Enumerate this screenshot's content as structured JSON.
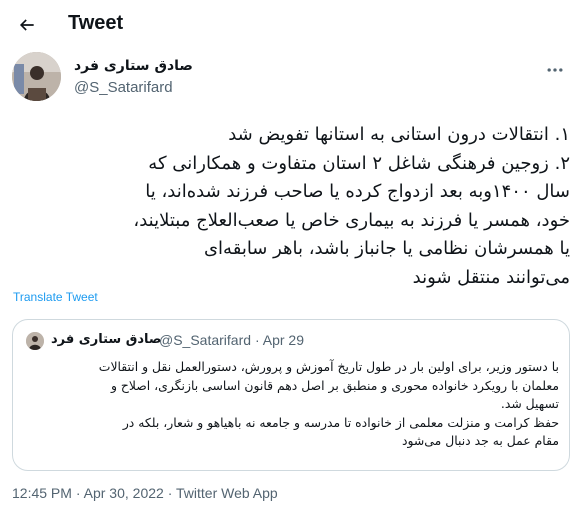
{
  "header": {
    "title": "Tweet",
    "back_icon": "arrow-left-icon"
  },
  "author": {
    "name": "صادق ستاری فرد",
    "handle": "@S_Satarifard",
    "more_icon": "more-horizontal-icon"
  },
  "tweet": {
    "lines": [
      "۱. انتقالات درون استانی به استانها تفویض شد",
      "۲. زوجین فرهنگی شاغل ۲ استان متفاوت و همکارانی که",
      "سال ۱۴۰۰وبه بعد ازدواج کرده یا صاحب فرزند شده‌اند، یا",
      "خود، همسر یا فرزند به بیماری خاص یا صعب‌العلاج مبتلایند،",
      "یا همسرشان نظامی یا جانباز باشد، باهر سابقه‌ای",
      "می‌توانند منتقل شوند"
    ],
    "translate_label": "Translate Tweet"
  },
  "quote": {
    "name": "صادق ستاری فرد",
    "handle": "@S_Satarifard",
    "separator": "·",
    "date": "Apr 29",
    "lines": [
      "با دستور وزیر، برای اولین بار در طول تاریخ آموزش و پرورش، دستورالعمل نقل و انتقالات",
      "معلمان با رویکرد خانواده محوری و منطبق بر اصل دهم قانون اساسی بازنگری، اصلاح و",
      "تسهیل شد.",
      "حفظ کرامت و منزلت معلمی از خانواده تا مدرسه و جامعه نه باهیاهو و شعار، بلکه در",
      "مقام عمل به جد دنبال می‌شود"
    ]
  },
  "footer": {
    "time": "12:45 PM",
    "separator1": "·",
    "date": "Apr 30, 2022",
    "separator2": "·",
    "source": "Twitter Web App"
  },
  "colors": {
    "text": "#0f1419",
    "secondary": "#536471",
    "link": "#1d9bf0",
    "border": "#cfd9de"
  }
}
